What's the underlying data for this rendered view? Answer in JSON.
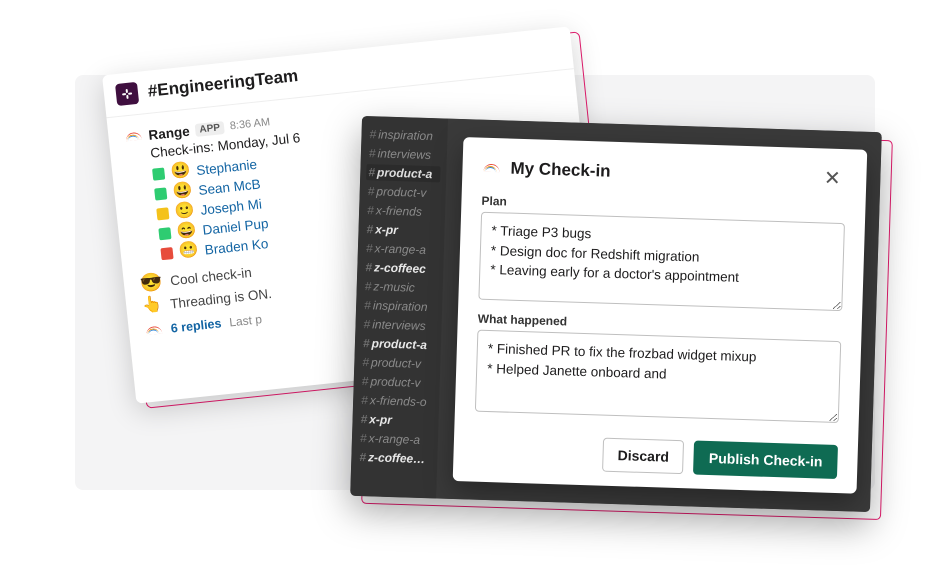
{
  "slack": {
    "channel": "#EngineeringTeam",
    "app_name": "Range",
    "app_tag": "APP",
    "time": "8:36 AM",
    "title": "Check-ins: Monday, Jul 6",
    "people": [
      {
        "status": "g",
        "emoji": "😃",
        "name": "Stephanie"
      },
      {
        "status": "g",
        "emoji": "😃",
        "name": "Sean McB"
      },
      {
        "status": "y",
        "emoji": "🙂",
        "name": "Joseph Mi"
      },
      {
        "status": "g",
        "emoji": "😄",
        "name": "Daniel Pup"
      },
      {
        "status": "r",
        "emoji": "😬",
        "name": "Braden Ko"
      }
    ],
    "cool_emoji": "😎",
    "cool_text": "Cool check-in",
    "thread_emoji": "👆",
    "thread_text": "Threading is ON.",
    "replies_count": "6 replies",
    "replies_last": "Last p"
  },
  "sidebar": {
    "items": [
      {
        "label": "inspiration",
        "cls": ""
      },
      {
        "label": "interviews",
        "cls": ""
      },
      {
        "label": "product-a",
        "cls": "active"
      },
      {
        "label": "product-v",
        "cls": ""
      },
      {
        "label": "x-friends",
        "cls": ""
      },
      {
        "label": "x-pr",
        "cls": "bold"
      },
      {
        "label": "x-range-a",
        "cls": ""
      },
      {
        "label": "z-coffeec",
        "cls": "bold"
      },
      {
        "label": "z-music",
        "cls": ""
      },
      {
        "label": "inspiration",
        "cls": ""
      },
      {
        "label": "interviews",
        "cls": ""
      },
      {
        "label": "product-a",
        "cls": "bold"
      },
      {
        "label": "product-v",
        "cls": ""
      },
      {
        "label": "product-v",
        "cls": ""
      },
      {
        "label": "x-friends-o",
        "cls": ""
      },
      {
        "label": "x-pr",
        "cls": "bold"
      },
      {
        "label": "x-range-a",
        "cls": ""
      },
      {
        "label": "z-coffeecooler",
        "cls": "bold"
      }
    ]
  },
  "modal": {
    "title": "My Check-in",
    "plan_label": "Plan",
    "plan_value": "* Triage P3 bugs\n* Design doc for Redshift migration\n* Leaving early for a doctor's appointment",
    "happened_label": "What happened",
    "happened_value": "* Finished PR to fix the frozbad widget mixup\n* Helped Janette onboard and",
    "discard": "Discard",
    "publish": "Publish Check-in"
  }
}
